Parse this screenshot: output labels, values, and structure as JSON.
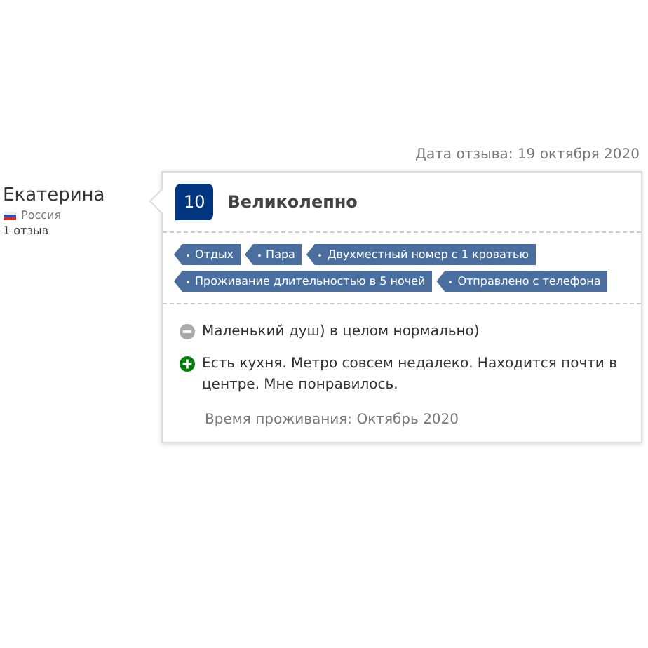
{
  "review_date": "Дата отзыва: 19 октября 2020",
  "reviewer": {
    "name": "Екатерина",
    "country": "Россия",
    "reviews_count": "1 отзыв"
  },
  "score": {
    "value": "10",
    "label": "Великолепно"
  },
  "tags": [
    {
      "label": "Отдых"
    },
    {
      "label": "Пара"
    },
    {
      "label": "Двухместный номер с 1 кроватью"
    },
    {
      "label": "Проживание длительностью в 5 ночей"
    },
    {
      "label": "Отправлено с телефона"
    }
  ],
  "comments": [
    {
      "kind": "negative",
      "text": "Маленький душ) в целом нормально)"
    },
    {
      "kind": "positive",
      "text": "Есть кухня. Метро совсем недалеко. Находится почти в центре. Мне понравилось."
    }
  ],
  "stay_period": "Время проживания: Октябрь 2020"
}
